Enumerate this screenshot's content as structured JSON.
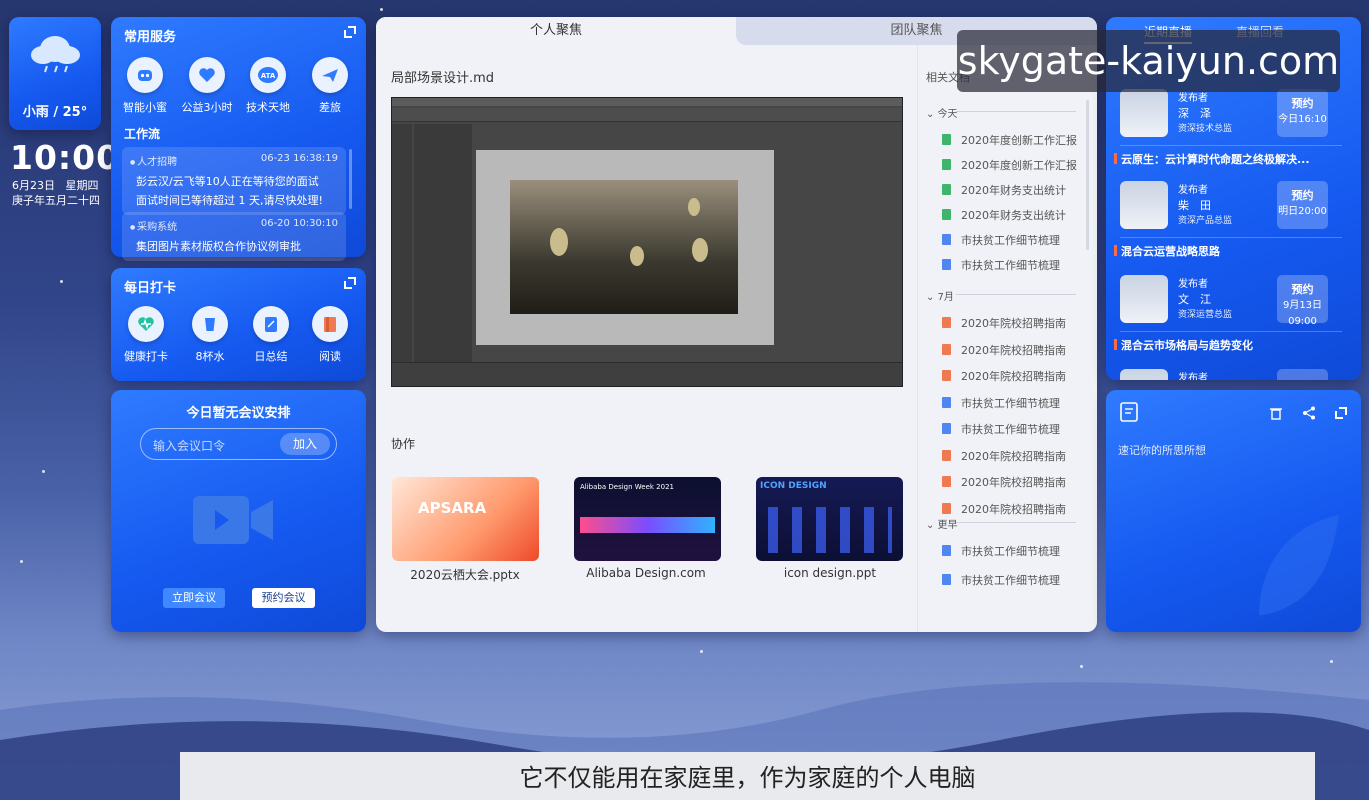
{
  "weather": {
    "text": "小雨 / 25°"
  },
  "clock": {
    "time": "10:00",
    "date": "6月23日",
    "weekday": "星期四",
    "lunar": "庚子年五月二十四"
  },
  "common_services": {
    "title": "常用服务",
    "items": [
      {
        "label": "智能小蜜",
        "icon": "robot-icon"
      },
      {
        "label": "公益3小时",
        "icon": "charity-icon"
      },
      {
        "label": "技术天地",
        "icon": "ata-icon"
      },
      {
        "label": "差旅",
        "icon": "plane-icon"
      }
    ],
    "workflow_title": "工作流",
    "workflow": [
      {
        "source": "人才招聘",
        "time": "06-23 16:38:19",
        "lines": [
          "彭云汉/云飞等10人正在等待您的面试",
          "面试时间已等待超过 1 天,请尽快处理!"
        ]
      },
      {
        "source": "采购系统",
        "time": "06-20 10:30:10",
        "lines": [
          "集团图片素材版权合作协议例审批"
        ]
      }
    ]
  },
  "daily_checkin": {
    "title": "每日打卡",
    "items": [
      {
        "label": "健康打卡",
        "icon": "heart-pulse-icon"
      },
      {
        "label": "8杯水",
        "icon": "cup-icon"
      },
      {
        "label": "日总结",
        "icon": "notepad-icon"
      },
      {
        "label": "阅读",
        "icon": "book-icon"
      }
    ]
  },
  "meeting": {
    "title": "今日暂无会议安排",
    "input_placeholder": "输入会议口令",
    "join_label": "加入",
    "start_label": "立即会议",
    "schedule_label": "预约会议"
  },
  "center": {
    "tab_personal": "个人聚焦",
    "tab_team": "团队聚焦",
    "doc_title": "局部场景设计.md",
    "coop_title": "协作",
    "thumbnails": [
      {
        "label": "2020云栖大会.pptx",
        "brand": "APSARA"
      },
      {
        "label": "Alibaba Design.com",
        "brand": "Alibaba Design Week 2021"
      },
      {
        "label": "icon design.ppt",
        "brand": "ICON DESIGN"
      }
    ],
    "related_title": "相关文档",
    "groups": [
      {
        "name": "今天",
        "docs": [
          {
            "name": "2020年度创新工作汇报",
            "color": "#3fb56b"
          },
          {
            "name": "2020年度创新工作汇报",
            "color": "#3fb56b"
          },
          {
            "name": "2020年财务支出统计",
            "color": "#3fb56b"
          },
          {
            "name": "2020年财务支出统计",
            "color": "#3fb56b"
          },
          {
            "name": "市扶贫工作细节梳理",
            "color": "#4f86f0"
          },
          {
            "name": "市扶贫工作细节梳理",
            "color": "#4f86f0"
          }
        ]
      },
      {
        "name": "7月",
        "docs": [
          {
            "name": "2020年院校招聘指南",
            "color": "#f07a4f"
          },
          {
            "name": "2020年院校招聘指南",
            "color": "#f07a4f"
          },
          {
            "name": "2020年院校招聘指南",
            "color": "#f07a4f"
          },
          {
            "name": "市扶贫工作细节梳理",
            "color": "#4f86f0"
          },
          {
            "name": "市扶贫工作细节梳理",
            "color": "#4f86f0"
          },
          {
            "name": "2020年院校招聘指南",
            "color": "#f07a4f"
          },
          {
            "name": "2020年院校招聘指南",
            "color": "#f07a4f"
          },
          {
            "name": "2020年院校招聘指南",
            "color": "#f07a4f"
          }
        ]
      },
      {
        "name": "更早",
        "docs": [
          {
            "name": "市扶贫工作细节梳理",
            "color": "#4f86f0"
          },
          {
            "name": "市扶贫工作细节梳理",
            "color": "#4f86f0"
          }
        ]
      }
    ]
  },
  "live": {
    "tab_recent": "近期直播",
    "tab_replay": "直播回看",
    "publisher_label": "发布者",
    "appt_label": "预约",
    "items": [
      {
        "name": "深　泽",
        "role": "资深技术总监",
        "time": "今日16:10",
        "topic": "云原生：云计算时代命题之终极解决..."
      },
      {
        "name": "柴　田",
        "role": "资深产品总监",
        "time": "明日20:00",
        "topic": "混合云运营战略思路"
      },
      {
        "name": "文　江",
        "role": "资深运营总监",
        "time": "9月13日 09:00",
        "topic": "混合云市场格局与趋势变化"
      },
      {
        "name": "",
        "role": "",
        "time": "",
        "topic": ""
      }
    ]
  },
  "note": {
    "placeholder": "速记你的所思所想"
  },
  "watermark": "skygate-kaiyun.com",
  "subtitle": "它不仅能用在家庭里，作为家庭的个人电脑"
}
